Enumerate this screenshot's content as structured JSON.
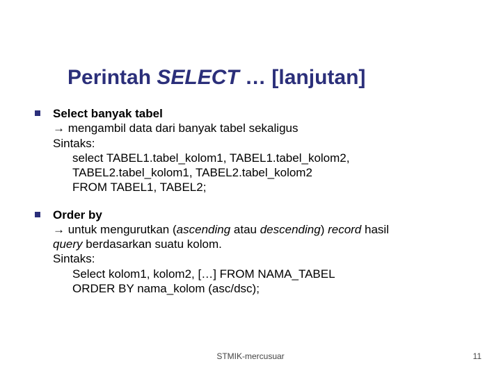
{
  "title": {
    "pre": "Perintah ",
    "italic": "SELECT",
    "post": " … [lanjutan]"
  },
  "items": [
    {
      "heading": "Select banyak tabel",
      "arrow_line": "→ mengambil data dari banyak tabel sekaligus",
      "sintaks_label": "Sintaks:",
      "code": [
        "select TABEL1.tabel_kolom1, TABEL1.tabel_kolom2,",
        "TABEL2.tabel_kolom1, TABEL2.tabel_kolom2",
        "FROM TABEL1, TABEL2;"
      ]
    },
    {
      "heading": "Order by",
      "arrow_pre": "→ untuk mengurutkan (",
      "arrow_it1": "ascending",
      "arrow_mid": " atau ",
      "arrow_it2": "descending",
      "arrow_post1": ") ",
      "arrow_it3": "record",
      "arrow_post2": " hasil ",
      "line2_it": "query",
      "line2_rest": " berdasarkan suatu kolom.",
      "sintaks_label": "Sintaks:",
      "code": [
        "Select  kolom1, kolom2, […] FROM NAMA_TABEL",
        "ORDER BY nama_kolom (asc/dsc);"
      ]
    }
  ],
  "footer": {
    "center": "STMIK-mercusuar",
    "page": "11"
  }
}
